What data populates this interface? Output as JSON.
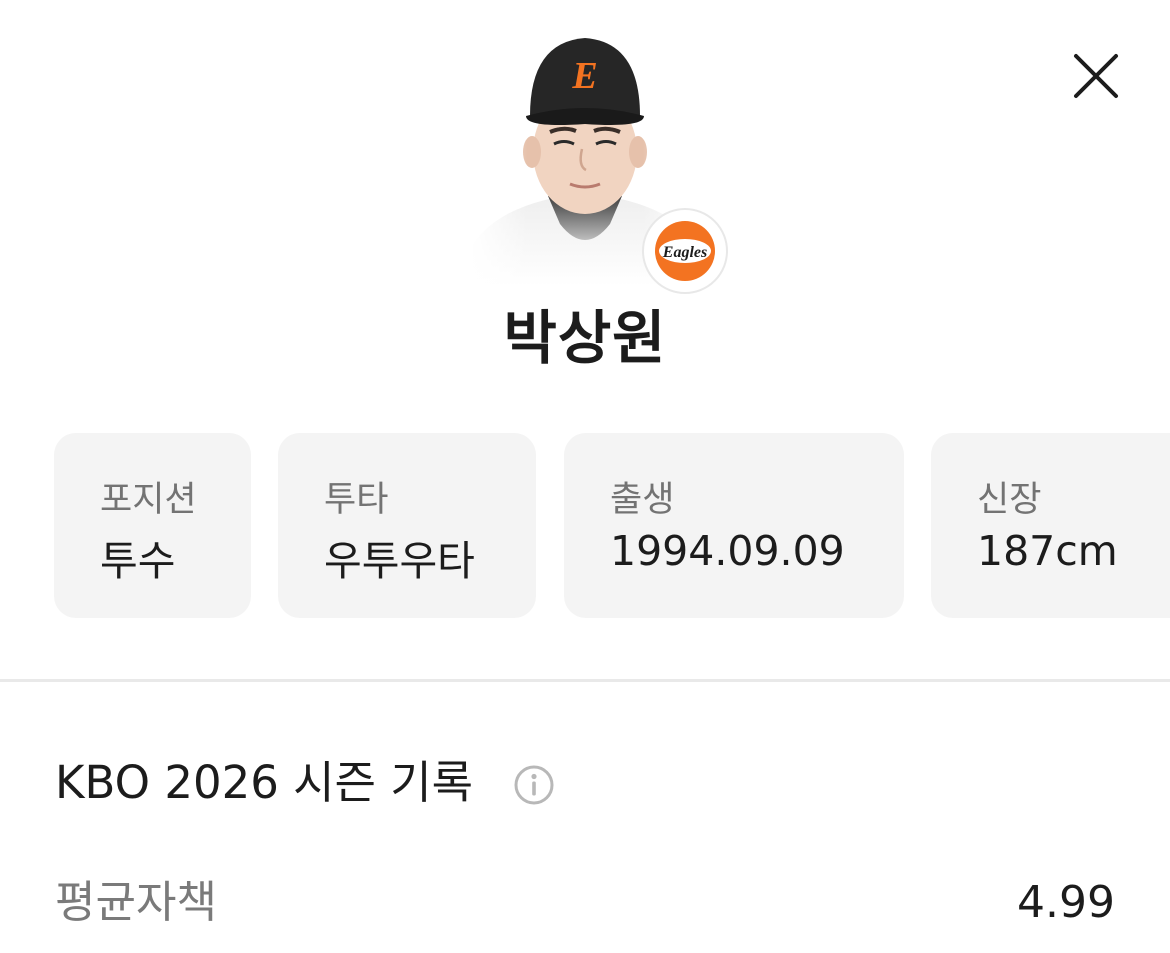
{
  "player": {
    "name": "박상원",
    "cap_letter": "E",
    "team_logo_text": "Eagles"
  },
  "info_cards": [
    {
      "label": "포지션",
      "value": "투수"
    },
    {
      "label": "투타",
      "value": "우투우타"
    },
    {
      "label": "출생",
      "value": "1994.09.09"
    },
    {
      "label": "신장",
      "value": "187cm"
    }
  ],
  "season": {
    "title": "KBO 2026 시즌 기록",
    "stats": [
      {
        "label": "평균자책",
        "value": "4.99"
      }
    ]
  },
  "icons": {
    "close": "close-icon",
    "info": "info-icon"
  },
  "colors": {
    "accent": "#f37321",
    "card_bg": "#f4f4f4",
    "text_primary": "#1c1c1c",
    "text_secondary": "#737373"
  }
}
